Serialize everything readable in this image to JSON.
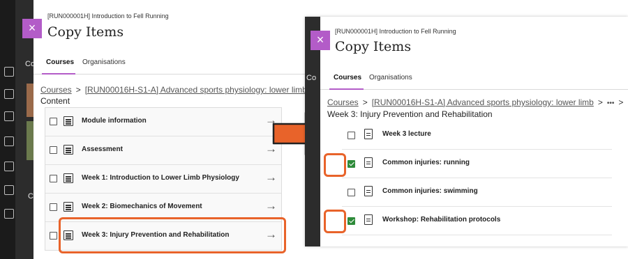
{
  "left": {
    "course_code": "[RUN000001H] Introduction to Fell Running",
    "title": "Copy Items",
    "close_glyph": "×",
    "tabs": [
      "Courses",
      "Organisations"
    ],
    "breadcrumb": {
      "root": "Courses",
      "separator": ">",
      "course": "[RUN00016H-S1-A] Advanced sports physiology: lower limb",
      "trail_separator": ">"
    },
    "section": "Content",
    "items": [
      "Module information",
      "Assessment",
      "Week 1: Introduction to Lower Limb Physiology",
      "Week 2: Biomechanics of Movement",
      "Week 3: Injury Prevention and Rehabilitation"
    ],
    "arrow_glyph": "→",
    "background_labels": [
      "Co",
      "C"
    ]
  },
  "right": {
    "course_code": "[RUN000001H] Introduction to Fell Running",
    "title": "Copy Items",
    "close_glyph": "×",
    "tabs": [
      "Courses",
      "Organisations"
    ],
    "breadcrumb": {
      "root": "Courses",
      "separator": ">",
      "course": "[RUN00016H-S1-A] Advanced sports physiology: lower limb",
      "more": "•••",
      "trail_separator": ">"
    },
    "section": "Week 3: Injury Prevention and Rehabilitation",
    "items": [
      {
        "label": "Week 3 lecture",
        "checked": false
      },
      {
        "label": "Common injuries: running",
        "checked": true
      },
      {
        "label": "Common injuries: swimming",
        "checked": false
      },
      {
        "label": "Workshop: Rehabilitation protocols",
        "checked": true
      }
    ],
    "background_labels": [
      "Co"
    ]
  },
  "colors": {
    "accent": "#b35cc8",
    "highlight": "#e8632a",
    "checked": "#2e8b3a"
  }
}
